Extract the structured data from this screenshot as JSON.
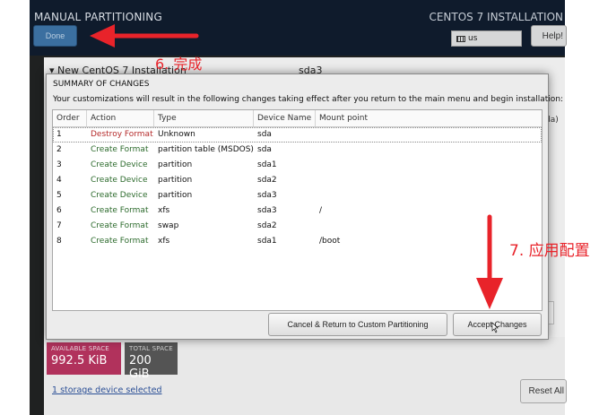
{
  "header": {
    "app_title": "MANUAL PARTITIONING",
    "product_title": "CENTOS 7 INSTALLATION",
    "done_label": "Done",
    "keyboard_layout": "us",
    "help_label": "Help!"
  },
  "background": {
    "tree_title": "▾ New CentOS 7 Installation",
    "device_title": "sda3",
    "side_device_hint": "da)",
    "available_space_label": "AVAILABLE SPACE",
    "available_space_value": "992.5 KiB",
    "total_space_label": "TOTAL SPACE",
    "total_space_value": "200 GiB",
    "storage_link": "1 storage device selected",
    "reset_label": "Reset All"
  },
  "dialog": {
    "title": "SUMMARY OF CHANGES",
    "description": "Your customizations will result in the following changes taking effect after you return to the main menu and begin installation:",
    "columns": [
      "Order",
      "Action",
      "Type",
      "Device Name",
      "Mount point"
    ],
    "rows": [
      {
        "order": "1",
        "action": "Destroy Format",
        "type": "Unknown",
        "device": "sda",
        "mount": ""
      },
      {
        "order": "2",
        "action": "Create Format",
        "type": "partition table (MSDOS)",
        "device": "sda",
        "mount": ""
      },
      {
        "order": "3",
        "action": "Create Device",
        "type": "partition",
        "device": "sda1",
        "mount": ""
      },
      {
        "order": "4",
        "action": "Create Device",
        "type": "partition",
        "device": "sda2",
        "mount": ""
      },
      {
        "order": "5",
        "action": "Create Device",
        "type": "partition",
        "device": "sda3",
        "mount": ""
      },
      {
        "order": "6",
        "action": "Create Format",
        "type": "xfs",
        "device": "sda3",
        "mount": "/"
      },
      {
        "order": "7",
        "action": "Create Format",
        "type": "swap",
        "device": "sda2",
        "mount": ""
      },
      {
        "order": "8",
        "action": "Create Format",
        "type": "xfs",
        "device": "sda1",
        "mount": "/boot"
      }
    ],
    "cancel_label": "Cancel & Return to Custom Partitioning",
    "accept_label": "Accept Changes"
  },
  "annotations": {
    "done_note": "6. 完成",
    "accept_note": "7. 应用配置",
    "arrow_color": "#e8232a"
  },
  "colors": {
    "destroy_action": "#b52b2b",
    "create_action": "#2d6b2d",
    "available_space_tile": "#b1325c",
    "total_space_tile": "#545454",
    "done_button": "#3b6fa0"
  }
}
